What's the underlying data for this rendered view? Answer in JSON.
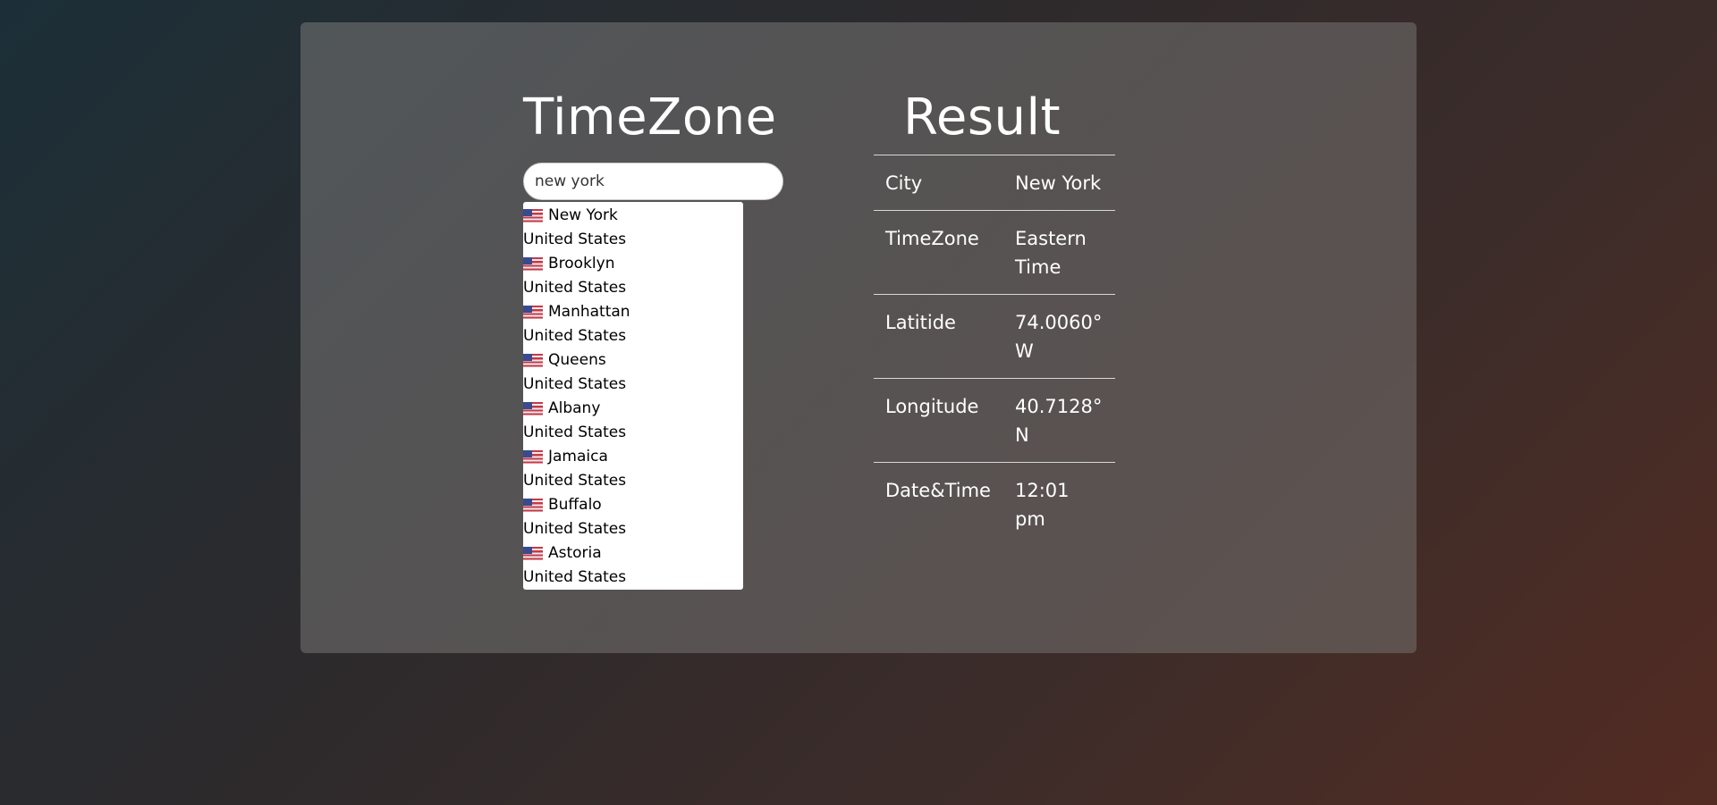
{
  "left": {
    "title": "TimeZone",
    "search": {
      "value": "new york",
      "placeholder": ""
    },
    "suggestions": [
      {
        "city": "New York",
        "country": "United States",
        "flag": "us-flag-icon"
      },
      {
        "city": "Brooklyn",
        "country": "United States",
        "flag": "us-flag-icon"
      },
      {
        "city": "Manhattan",
        "country": "United States",
        "flag": "us-flag-icon"
      },
      {
        "city": "Queens",
        "country": "United States",
        "flag": "us-flag-icon"
      },
      {
        "city": "Albany",
        "country": "United States",
        "flag": "us-flag-icon"
      },
      {
        "city": "Jamaica",
        "country": "United States",
        "flag": "us-flag-icon"
      },
      {
        "city": "Buffalo",
        "country": "United States",
        "flag": "us-flag-icon"
      },
      {
        "city": "Astoria",
        "country": "United States",
        "flag": "us-flag-icon"
      }
    ]
  },
  "right": {
    "title": "Result",
    "rows": [
      {
        "label": "City",
        "value": "New York"
      },
      {
        "label": "TimeZone",
        "value": "Eastern Time"
      },
      {
        "label": "Latitide",
        "value": "74.0060° W"
      },
      {
        "label": "Longitude",
        "value": "40.7128° N"
      },
      {
        "label": "Date&Time",
        "value": "12:01 pm"
      }
    ]
  },
  "colors": {
    "panel": "#6e6c6b",
    "flag_red": "#c33b4a",
    "flag_blue": "#3b4a8f"
  }
}
